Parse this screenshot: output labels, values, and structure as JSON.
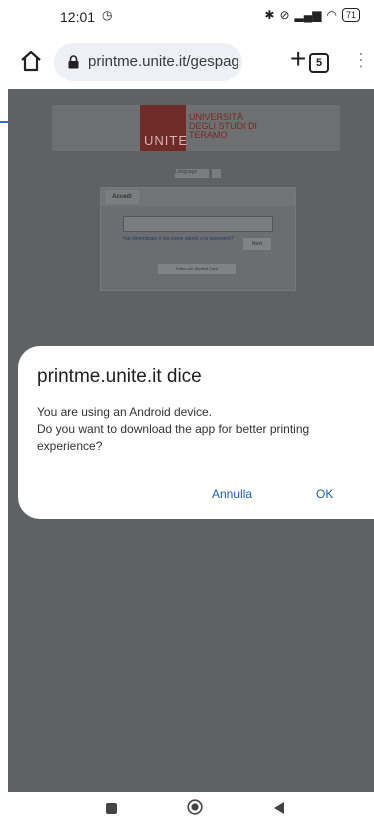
{
  "status": {
    "time": "12:01",
    "battery": "71"
  },
  "browser": {
    "url": "printme.unite.it/gespage/",
    "tab_count": "5",
    "new_tab": "+"
  },
  "webpage": {
    "logo_main": "UNITE",
    "logo_text": "UNIVERSITÀ DEGLI STUDI DI TERAMO",
    "language_label": "Language",
    "login_tab": "Accedi",
    "forgot_link": "Hai dimenticato il tuo nome utente o la password?",
    "next_button": "Next",
    "alt_login_button": "Entra con Student Card"
  },
  "dialog": {
    "title": "printme.unite.it dice",
    "message": "You are using an Android device.\nDo you want to download the app for better printing experience?",
    "cancel_label": "Annulla",
    "ok_label": "OK"
  },
  "colors": {
    "accent": "#1d5fa8",
    "progress": "#2d6ed8",
    "scrim_page": "#5f6264"
  }
}
